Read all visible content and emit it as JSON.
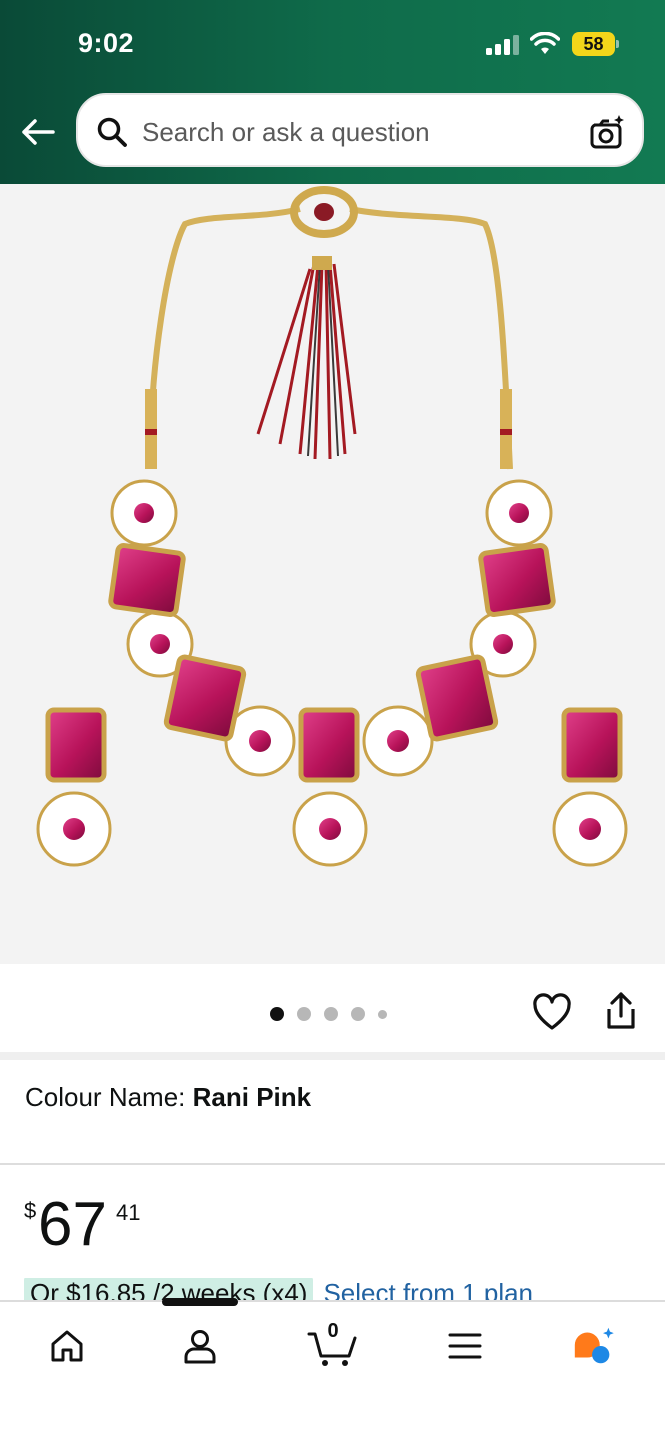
{
  "status_bar": {
    "time": "9:02",
    "battery": "58"
  },
  "header": {
    "search": {
      "placeholder": "Search or ask a question"
    }
  },
  "gallery": {
    "image_count": 5,
    "active_index": 0
  },
  "product": {
    "colour_label": "Colour Name: ",
    "colour_value": "Rani Pink",
    "price": {
      "currency": "$",
      "whole": "67",
      "fraction": "41"
    },
    "installment": {
      "text": "Or $16.85 /2 weeks (x4)",
      "link": "Select from 1 plan"
    }
  },
  "bottom_nav": {
    "cart_count": "0"
  },
  "colors": {
    "header_dark": "#0a4a37",
    "header_light": "#127a52",
    "link": "#2162a1",
    "gem": "#c2185b",
    "gold": "#d4b15a"
  }
}
